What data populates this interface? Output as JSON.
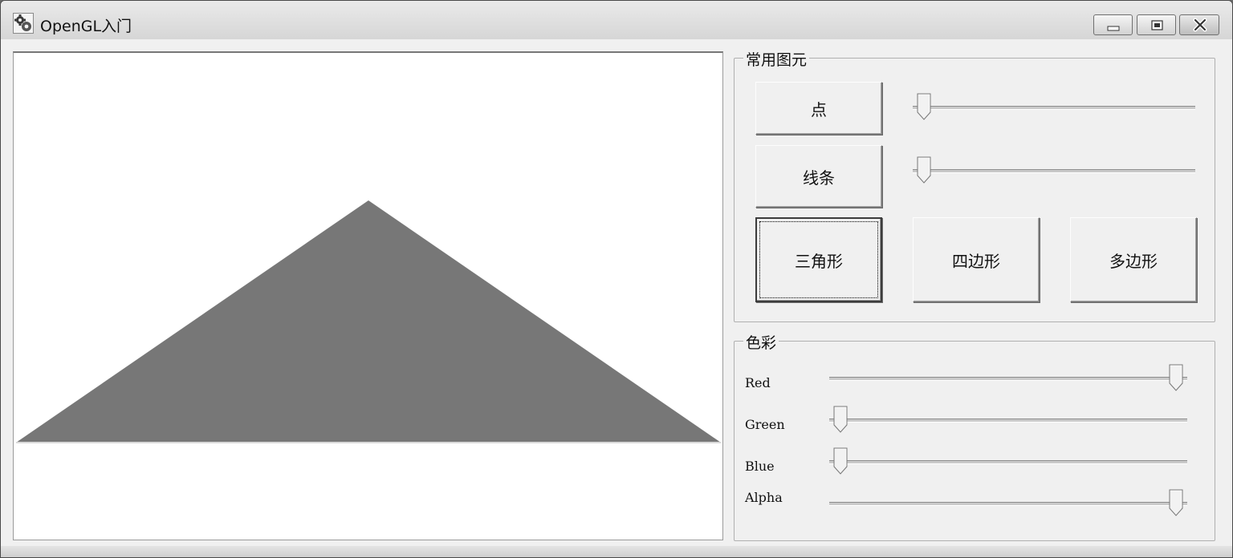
{
  "window": {
    "title": "OpenGL入门",
    "icon": "app-gears-icon"
  },
  "title_buttons": {
    "minimize": "minimize-icon",
    "maximize": "maximize-icon",
    "close": "close-icon"
  },
  "canvas": {
    "shape": "triangle",
    "fill_color": "#777777",
    "background": "#ffffff"
  },
  "primitives": {
    "group_title": "常用图元",
    "point_button": "点",
    "line_button": "线条",
    "triangle_button": "三角形",
    "quad_button": "四边形",
    "polygon_button": "多边形",
    "point_size_slider": 0,
    "line_width_slider": 0
  },
  "color": {
    "group_title": "色彩",
    "red_label": "Red",
    "green_label": "Green",
    "blue_label": "Blue",
    "alpha_label": "Alpha",
    "red_value": 1.0,
    "green_value": 0.0,
    "blue_value": 0.0,
    "alpha_value": 1.0
  }
}
